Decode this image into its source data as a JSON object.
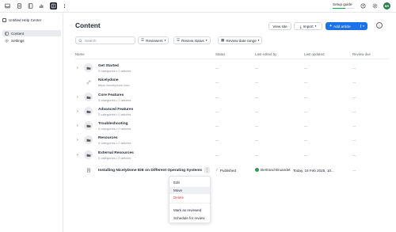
{
  "topbar": {
    "icons": [
      "inbox-icon",
      "document-icon",
      "book-icon",
      "chart-icon",
      "layout-icon",
      "more-icon"
    ],
    "setup_label": "Setup guide",
    "setup_progress": 0.6,
    "avatar_initials": "BR"
  },
  "sidebar": {
    "center_label": "Untitled Help Center",
    "items": [
      {
        "label": "Content",
        "icon": "content-icon"
      },
      {
        "label": "Settings",
        "icon": "gear-icon"
      }
    ]
  },
  "main": {
    "title": "Content",
    "view_site_label": "View site",
    "import_label": "Import",
    "add_article_label": "Add article",
    "search_placeholder": "Search",
    "filters": [
      "Reviewers",
      "Review status",
      "Review date range"
    ],
    "columns": [
      "Name",
      "Status",
      "Last edited by",
      "Last updated",
      "Review due"
    ],
    "rows": [
      {
        "title": "Get Started",
        "sub": "0 categories • 0 articles",
        "status": "—",
        "edited": "—",
        "updated": "—",
        "due": "—"
      },
      {
        "title": "Nicelydone",
        "sub": "https://nicelydone.club",
        "status": "—",
        "edited": "—",
        "updated": "—",
        "due": "—"
      },
      {
        "title": "Core Features",
        "sub": "0 categories • 0 articles",
        "status": "—",
        "edited": "—",
        "updated": "—",
        "due": "—"
      },
      {
        "title": "Advanced Features",
        "sub": "0 categories • 0 articles",
        "status": "—",
        "edited": "—",
        "updated": "—",
        "due": "—"
      },
      {
        "title": "Troubleshooting",
        "sub": "0 categories • 0 articles",
        "status": "—",
        "edited": "—",
        "updated": "—",
        "due": "—"
      },
      {
        "title": "Resources",
        "sub": "0 categories • 0 articles",
        "status": "—",
        "edited": "—",
        "updated": "—",
        "due": "—"
      },
      {
        "title": "External Resources",
        "sub": "0 categories • 0 articles",
        "status": "—",
        "edited": "—",
        "updated": "—",
        "due": "—"
      }
    ],
    "article_row": {
      "title": "Installing NicelyDone IDE on Different Operating Systems",
      "status": "Published",
      "edited_by": "Bertrand Bruandet",
      "updated": "Today, 19 Feb 2025, 10...",
      "due": "—"
    }
  },
  "context_menu": {
    "items": [
      "Edit",
      "Move",
      "Delete",
      "Mark as reviewed",
      "Schedule for review"
    ]
  },
  "colors": {
    "accent": "#1a73e8",
    "published": "#2e9a4e",
    "danger": "#d14343"
  }
}
